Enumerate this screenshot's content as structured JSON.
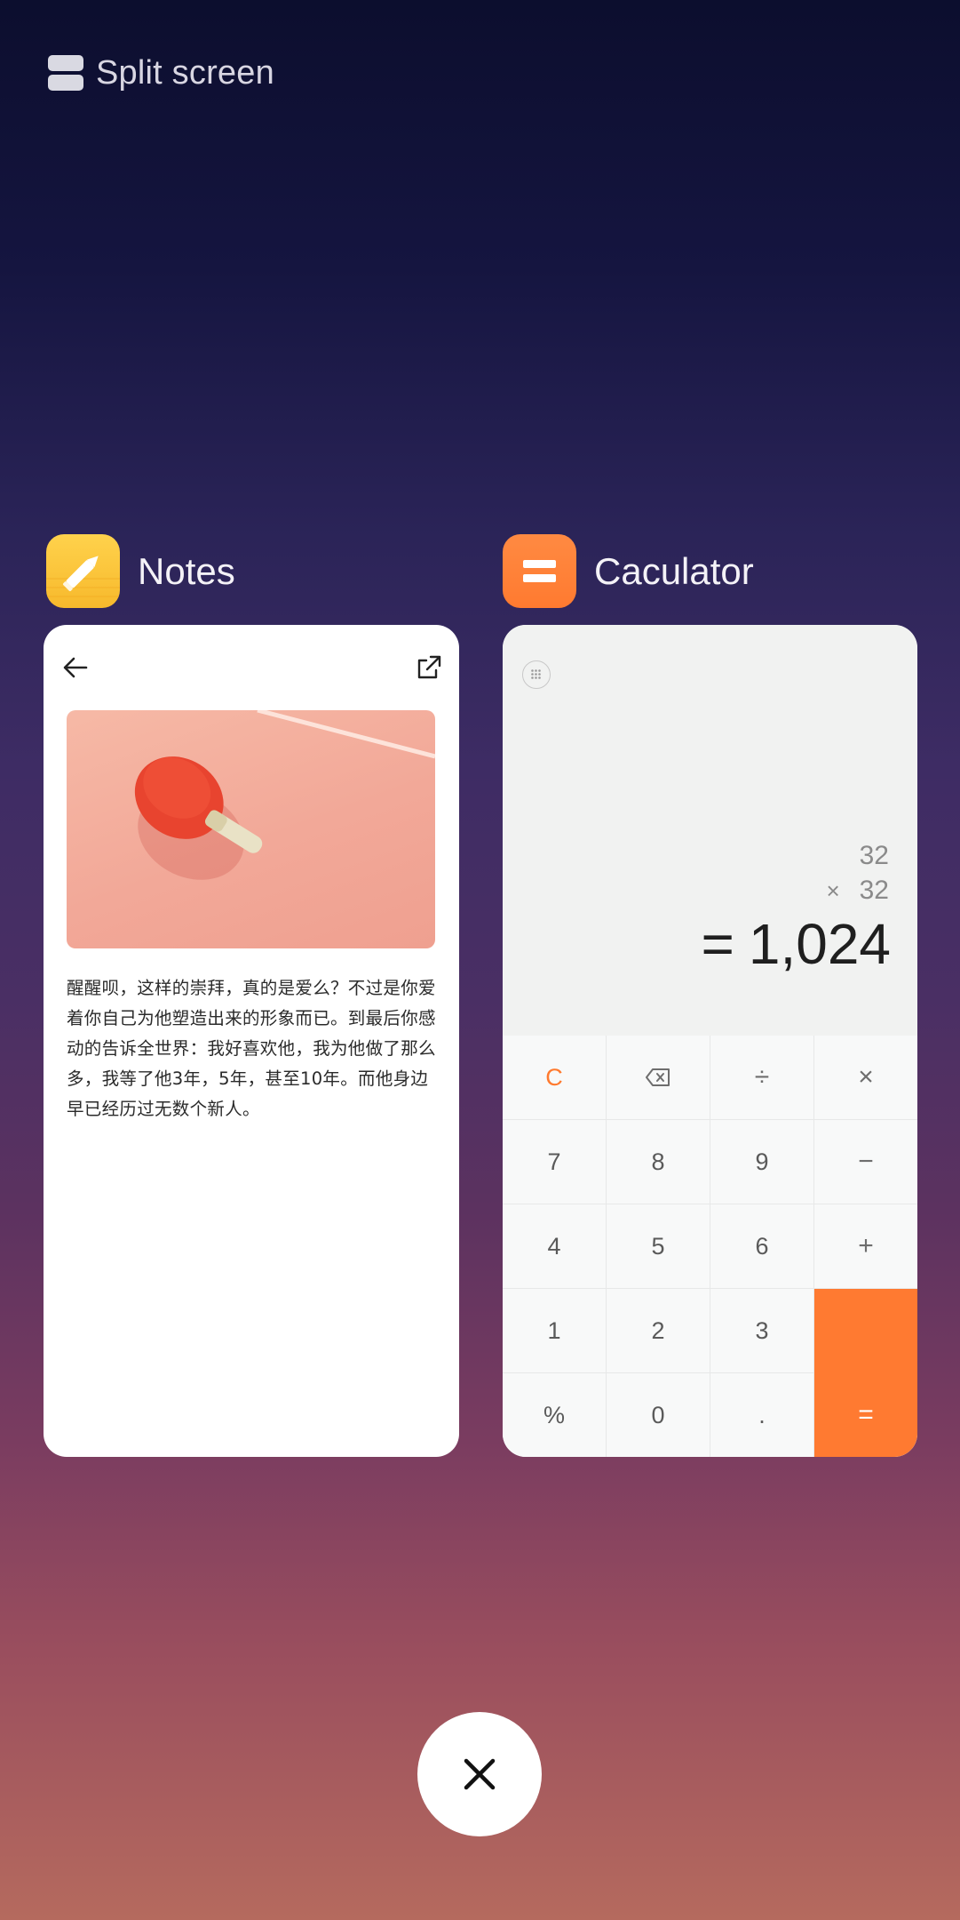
{
  "header": {
    "split_label": "Split screen",
    "split_icon": "split-screen-icon"
  },
  "notes_app": {
    "name": "Notes",
    "icon": "pencil-icon",
    "icon_color": "#ffc93a",
    "text": "醒醒呗，这样的崇拜，真的是爱么？不过是你爱着你自己为他塑造出来的形象而已。到最后你感动的告诉全世界：我好喜欢他，我为他做了那么多，我等了他3年，5年，甚至10年。而他身边早已经历过无数个新人。",
    "image": "ping-pong-paddle-photo"
  },
  "calc_app": {
    "name": "Caculator",
    "icon": "equals-icon",
    "icon_color": "#ff7f36",
    "expression_line1": "32",
    "expression_op": "×",
    "expression_line2": "32",
    "result_sign": "=",
    "result": "1,024",
    "keys": [
      {
        "label": "C",
        "name": "clear-key"
      },
      {
        "label": "⌫",
        "name": "backspace-key"
      },
      {
        "label": "÷",
        "name": "divide-key"
      },
      {
        "label": "×",
        "name": "multiply-key"
      },
      {
        "label": "7",
        "name": "digit-7-key"
      },
      {
        "label": "8",
        "name": "digit-8-key"
      },
      {
        "label": "9",
        "name": "digit-9-key"
      },
      {
        "label": "−",
        "name": "minus-key"
      },
      {
        "label": "4",
        "name": "digit-4-key"
      },
      {
        "label": "5",
        "name": "digit-5-key"
      },
      {
        "label": "6",
        "name": "digit-6-key"
      },
      {
        "label": "+",
        "name": "plus-key"
      },
      {
        "label": "1",
        "name": "digit-1-key"
      },
      {
        "label": "2",
        "name": "digit-2-key"
      },
      {
        "label": "3",
        "name": "digit-3-key"
      },
      {
        "label": "%",
        "name": "percent-key"
      },
      {
        "label": "0",
        "name": "digit-0-key"
      },
      {
        "label": ".",
        "name": "decimal-key"
      },
      {
        "label": "=",
        "name": "equals-key"
      }
    ],
    "accent": "#ff7a31"
  },
  "close_button": {
    "icon": "close-icon"
  }
}
